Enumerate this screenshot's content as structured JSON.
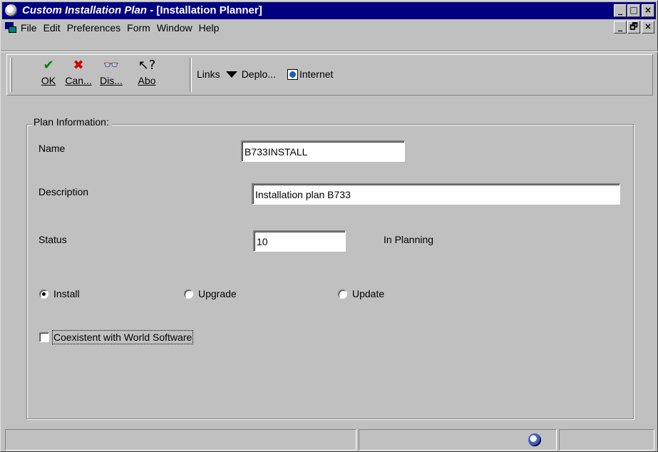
{
  "window": {
    "title_app": "Custom Installation Plan",
    "title_doc": " - [Installation Planner]",
    "controls": [
      "_",
      "□",
      "×"
    ],
    "mdi_controls": [
      "_",
      "🗗",
      "×"
    ]
  },
  "menu": {
    "items": [
      "File",
      "Edit",
      "Preferences",
      "Form",
      "Window",
      "Help"
    ]
  },
  "toolbar": {
    "buttons": [
      {
        "label": "OK",
        "icon": "✔"
      },
      {
        "label": "Can...",
        "icon": "✖"
      },
      {
        "label": "Dis...",
        "icon": "👓"
      },
      {
        "label": "Abo",
        "icon": "↖?"
      }
    ],
    "links_label": "Links",
    "deploy_label": "Deplo...",
    "internet_label": "Internet"
  },
  "plan": {
    "group_title": "Plan Information:",
    "name_label": "Name",
    "name_value": "B733INSTALL",
    "description_label": "Description",
    "description_value": "Installation plan B733",
    "status_label": "Status",
    "status_value": "10",
    "status_text": "In Planning",
    "radio_install": "Install",
    "radio_upgrade": "Upgrade",
    "radio_update": "Update",
    "selected_radio": "Install",
    "coexistent_label": "Coexistent with World Software",
    "coexistent_checked": false
  },
  "colors": {
    "titlebar": "#000080",
    "face": "#c0c0c0",
    "ok_green": "#008000",
    "cancel_red": "#d00000"
  }
}
